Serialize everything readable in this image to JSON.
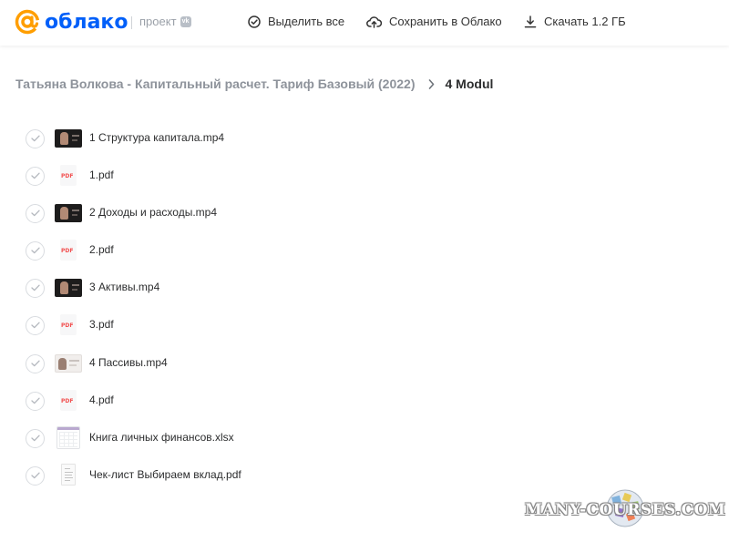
{
  "header": {
    "logo_text": "облако",
    "project_label": "проект",
    "vk_badge": "vk",
    "select_all": "Выделить все",
    "save_to_cloud": "Сохранить в Облако",
    "download": "Скачать 1.2 ГБ"
  },
  "breadcrumb": {
    "parent": "Татьяна Волкова - Капитальный расчет. Тариф Базовый (2022)",
    "current": "4 Modul"
  },
  "files": [
    {
      "name": "1 Структура капитала.mp4",
      "type": "video"
    },
    {
      "name": "1.pdf",
      "type": "pdf",
      "icon_text": "PDF"
    },
    {
      "name": "2 Доходы и расходы.mp4",
      "type": "video"
    },
    {
      "name": "2.pdf",
      "type": "pdf",
      "icon_text": "PDF"
    },
    {
      "name": "3 Активы.mp4",
      "type": "video"
    },
    {
      "name": "3.pdf",
      "type": "pdf",
      "icon_text": "PDF"
    },
    {
      "name": "4 Пассивы.mp4",
      "type": "video-light"
    },
    {
      "name": "4.pdf",
      "type": "pdf",
      "icon_text": "PDF"
    },
    {
      "name": "Книга личных финансов.xlsx",
      "type": "xlsx"
    },
    {
      "name": "Чек-лист Выбираем вклад.pdf",
      "type": "doc"
    }
  ],
  "watermark": "MANY-COURSES.COM",
  "colors": {
    "accent": "#005ff9",
    "logo_orange": "#ff9e00",
    "pdf_red": "#f25050"
  }
}
